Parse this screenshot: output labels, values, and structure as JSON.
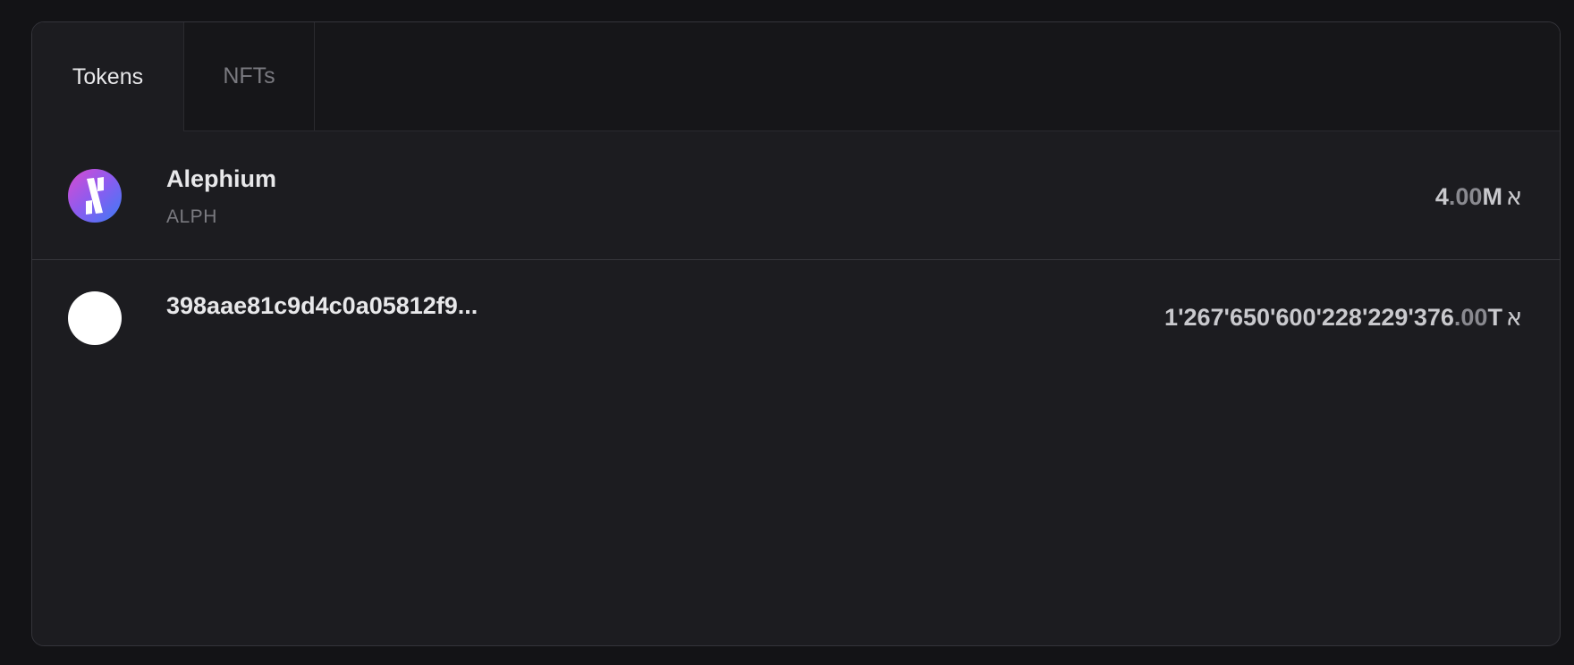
{
  "tabs": [
    {
      "label": "Tokens",
      "active": true
    },
    {
      "label": "NFTs",
      "active": false
    }
  ],
  "tokens": [
    {
      "name": "Alephium",
      "symbol": "ALPH",
      "amount_int": "4",
      "amount_dec": ".00",
      "amount_suffix": "M",
      "currency_symbol": "א",
      "icon": "alephium-logo-icon"
    },
    {
      "name": "398aae81c9d4c0a05812f9...",
      "symbol": "",
      "amount_int": "1'267'650'600'228'229'376",
      "amount_dec": ".00",
      "amount_suffix": "T",
      "currency_symbol": "א",
      "icon": "token-placeholder-icon"
    }
  ],
  "colors": {
    "background": "#131316",
    "panel": "#1c1c20",
    "tabbar": "#161619",
    "text_primary": "#e8e8ea",
    "text_secondary": "#7a7a80"
  }
}
